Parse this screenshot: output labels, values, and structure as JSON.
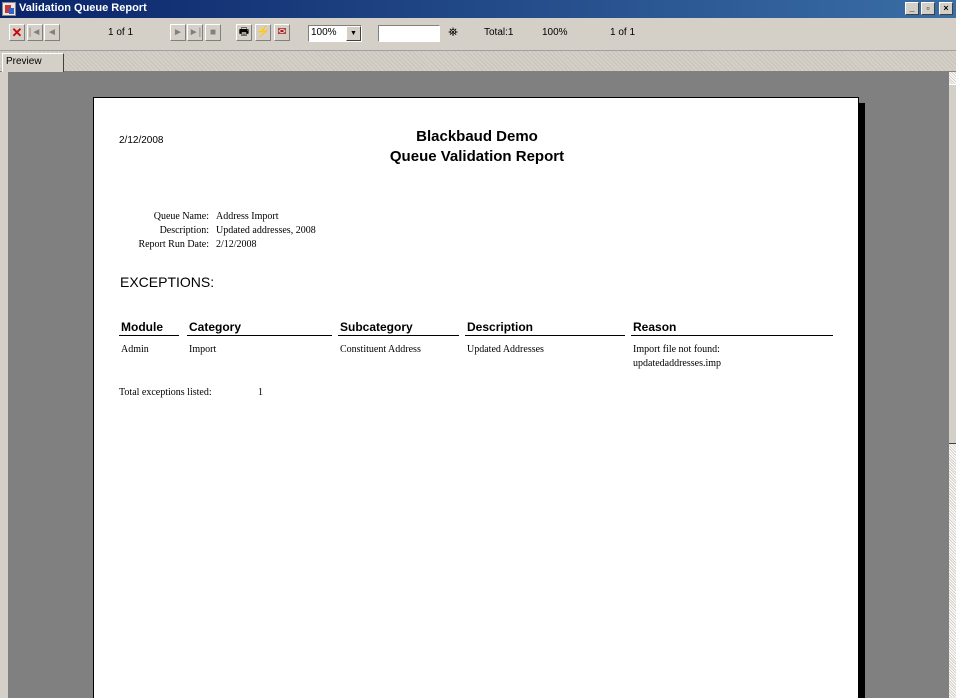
{
  "window": {
    "title": "Validation Queue Report",
    "minimize": "_",
    "maximize": "▫",
    "close": "×"
  },
  "toolbar": {
    "page_indicator": "1 of 1",
    "zoom_value": "100%",
    "search_value": "",
    "total_label": "Total:1",
    "percent_label": "100%",
    "page_of": "1 of 1"
  },
  "tabs": [
    "Preview"
  ],
  "report": {
    "date": "2/12/2008",
    "title_line1": "Blackbaud Demo",
    "title_line2": "Queue Validation Report",
    "meta": [
      {
        "label": "Queue Name:",
        "value": "Address Import"
      },
      {
        "label": "Description:",
        "value": "Updated addresses, 2008"
      },
      {
        "label": "Report Run Date:",
        "value": "2/12/2008"
      }
    ],
    "exceptions_heading": "EXCEPTIONS:",
    "columns": [
      "Module",
      "Category",
      "Subcategory",
      "Description",
      "Reason"
    ],
    "rows": [
      {
        "module": "Admin",
        "category": "Import",
        "subcategory": "Constituent Address",
        "description": "Updated Addresses",
        "reason_line1": "Import file not found:",
        "reason_line2": "updatedaddresses.imp"
      }
    ],
    "total_label": "Total exceptions listed:",
    "total_value": "1"
  }
}
